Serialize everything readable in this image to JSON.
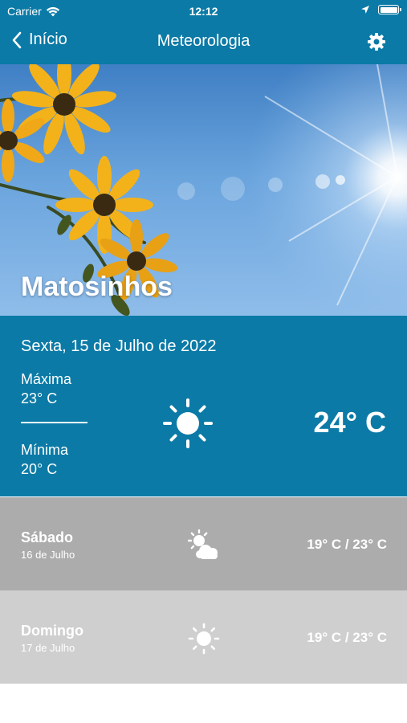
{
  "status_bar": {
    "carrier": "Carrier",
    "time": "12:12"
  },
  "nav": {
    "back_label": "Início",
    "title": "Meteorologia"
  },
  "hero": {
    "city": "Matosinhos"
  },
  "today": {
    "date": "Sexta, 15 de Julho de 2022",
    "max_label": "Máxima",
    "max_value": "23° C",
    "min_label": "Mínima",
    "min_value": "20° C",
    "current_temp": "24° C",
    "icon": "sun-icon"
  },
  "forecast": [
    {
      "day": "Sábado",
      "date": "16 de Julho",
      "range": "19° C / 23° C",
      "icon": "partly-cloudy-icon"
    },
    {
      "day": "Domingo",
      "date": "17 de Julho",
      "range": "19° C / 23° C",
      "icon": "sun-icon"
    }
  ],
  "colors": {
    "primary": "#0b7aa6",
    "row_dark": "#acacac",
    "row_light": "#cfcfcf"
  }
}
